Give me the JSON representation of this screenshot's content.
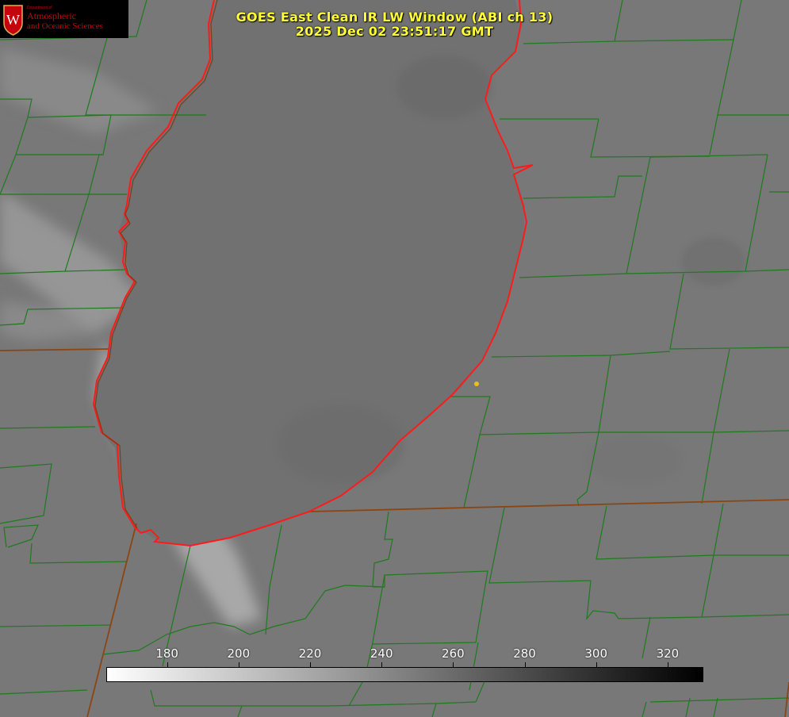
{
  "title": {
    "line1": "GOES East Clean IR LW Window (ABI ch 13)",
    "line2": "2025 Dec 02 23:51:17 GMT"
  },
  "logo": {
    "department": "Department of",
    "line1": "Atmospheric",
    "line2": "and Oceanic Sciences",
    "crest_letter": "W"
  },
  "colorbar": {
    "units_min": 163,
    "units_max": 330,
    "ticks": [
      "180",
      "200",
      "220",
      "240",
      "260",
      "280",
      "300",
      "320"
    ],
    "gradient_from": "#ffffff",
    "gradient_to": "#000000"
  },
  "colors": {
    "background": "#7a7a7a",
    "lake": "#6f6f6f",
    "county_lines": "#1f7a1f",
    "state_lines": "#8b4513",
    "coastline": "#ff1a1a",
    "title_text": "#ffff33",
    "marker": "#e6c21a",
    "logo_red": "#c5050c"
  }
}
